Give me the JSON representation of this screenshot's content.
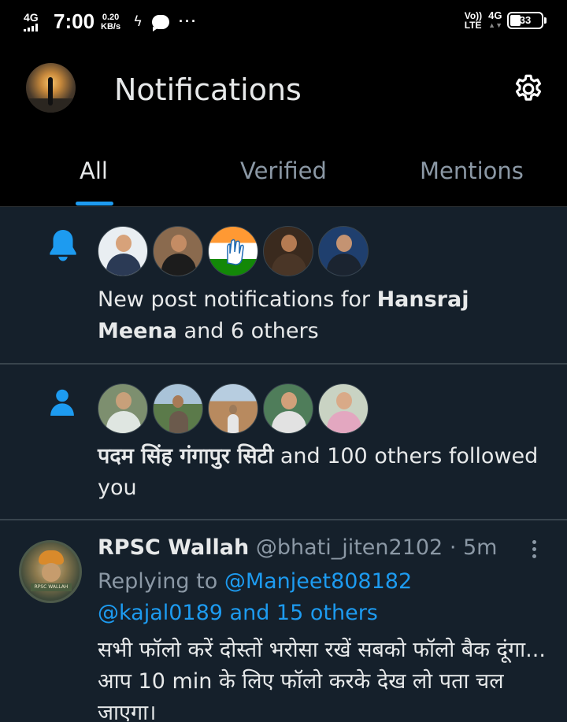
{
  "status_bar": {
    "network_left": "4G",
    "time": "7:00",
    "speed_value": "0.20",
    "speed_unit": "KB/s",
    "volte_top": "Vo))",
    "volte_bottom": "LTE",
    "network_right": "4G",
    "battery": "33"
  },
  "header": {
    "title": "Notifications"
  },
  "tabs": [
    {
      "label": "All",
      "active": true
    },
    {
      "label": "Verified",
      "active": false
    },
    {
      "label": "Mentions",
      "active": false
    }
  ],
  "notifications": [
    {
      "type_icon": "bell-icon",
      "text_pre": "New post notifications for ",
      "text_bold": "Hansraj Meena",
      "text_post": " and 6 others"
    },
    {
      "type_icon": "person-icon",
      "text_pre": "",
      "text_bold": "पदम सिंह गंगापुर सिटी",
      "text_post": " and 100 others followed you"
    }
  ],
  "tweet": {
    "name": "RPSC Wallah",
    "handle": "@bhati_jiten2102",
    "separator": " · ",
    "time": "5m",
    "avatar_caption": "RPSC WALLAH",
    "replying_prefix": "Replying to ",
    "reply_user1": "@Manjeet808182",
    "reply_user2": "@kajal0189",
    "reply_others": " and 15 others",
    "body": "सभी फॉलो करें दोस्तों भरोसा रखें सबको फॉलो बैक दूंगा... आप 10 min के लिए फॉलो करके देख लो पता चल जाएगा।"
  },
  "colors": {
    "accent": "#1d9bf0",
    "background": "#15202b",
    "header_bg": "#000000",
    "muted_text": "#8b98a5"
  }
}
